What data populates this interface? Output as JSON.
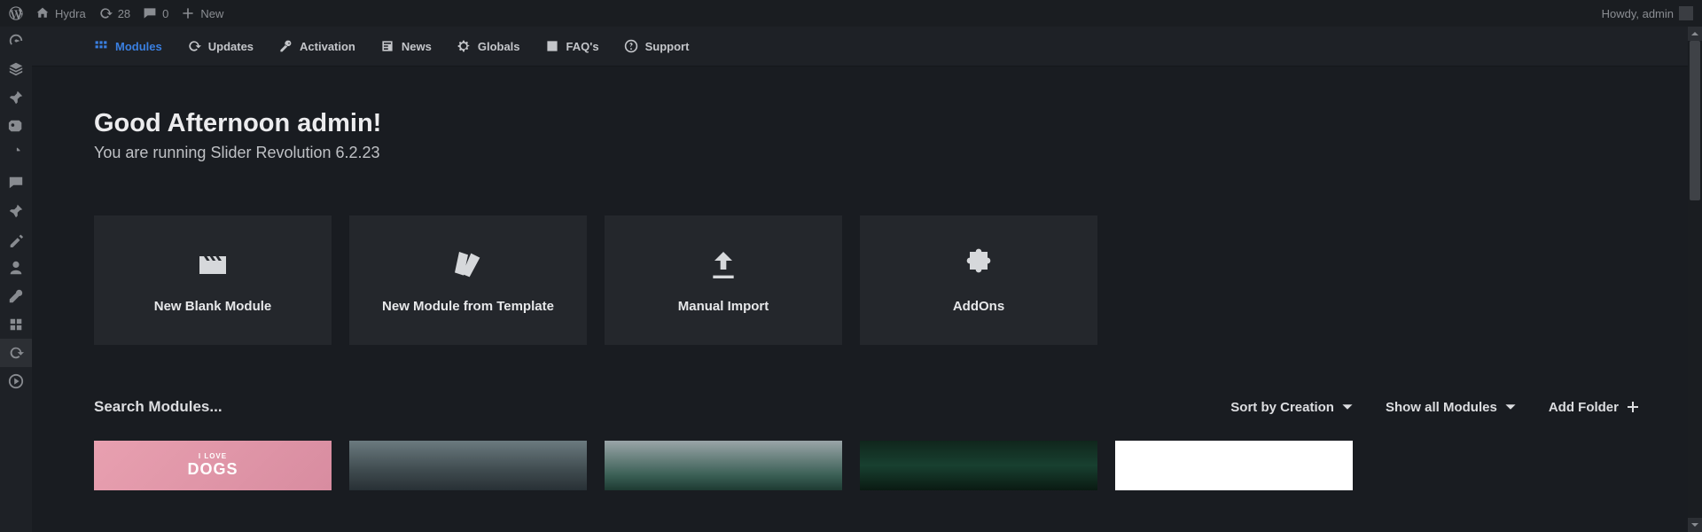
{
  "adminbar": {
    "site_name": "Hydra",
    "updates_count": "28",
    "comments_count": "0",
    "new_label": "New",
    "howdy": "Howdy, admin"
  },
  "plugnav": {
    "modules": "Modules",
    "updates": "Updates",
    "activation": "Activation",
    "news": "News",
    "globals": "Globals",
    "faqs": "FAQ's",
    "support": "Support"
  },
  "greeting": {
    "title": "Good Afternoon admin!",
    "subtitle": "You are running Slider Revolution 6.2.23"
  },
  "cards": {
    "blank": "New Blank Module",
    "template": "New Module from Template",
    "import": "Manual Import",
    "addons": "AddOns"
  },
  "modbar": {
    "search_placeholder": "Search Modules...",
    "sort": "Sort by Creation",
    "show": "Show all Modules",
    "add_folder": "Add Folder"
  },
  "thumbs": {
    "t1_line1": "I LOVE",
    "t1_line2": "DOGS"
  }
}
